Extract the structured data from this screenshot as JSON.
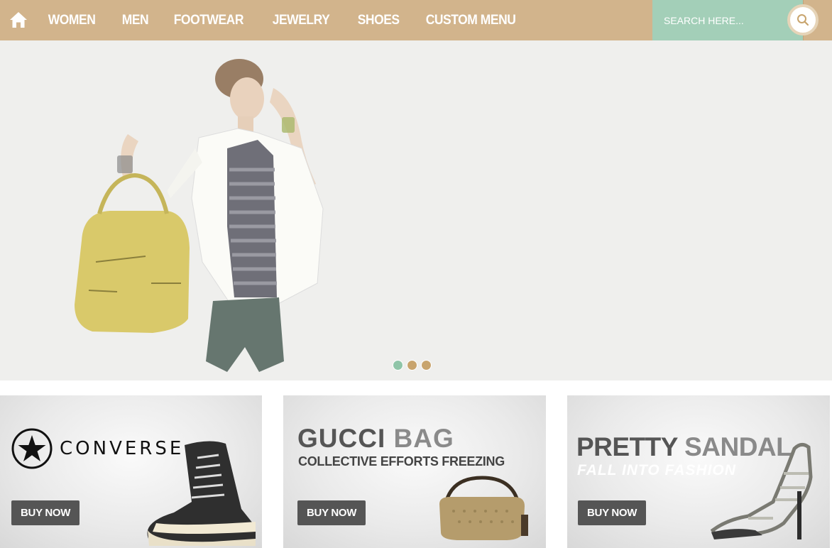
{
  "nav": {
    "home_icon": "home-icon",
    "items": [
      {
        "label": "WOMEN"
      },
      {
        "label": "MEN"
      },
      {
        "label": "FOOTWEAR"
      },
      {
        "label": "JEWELRY"
      },
      {
        "label": "SHOES"
      },
      {
        "label": "CUSTOM MENU"
      }
    ],
    "search": {
      "placeholder": "SEARCH HERE...",
      "icon": "search-icon"
    }
  },
  "slider": {
    "dots": [
      {
        "state": "active"
      },
      {
        "state": "inactive"
      },
      {
        "state": "inactive"
      }
    ]
  },
  "promos": [
    {
      "brand_text": "CONVERSE",
      "button_label": "BUY NOW"
    },
    {
      "title_dark": "GUCCI",
      "title_light": "BAG",
      "subtitle": "COLLECTIVE EFFORTS FREEZING",
      "button_label": "BUY NOW"
    },
    {
      "title_dark": "PRETTY",
      "title_light": "SANDAL",
      "subtitle": "FALL INTO FASHION",
      "button_label": "BUY NOW"
    }
  ],
  "colors": {
    "nav_bg": "#d2b48c",
    "search_bg": "#a3cfb8",
    "button_bg": "#555555",
    "dot_active": "#8fc5a8",
    "dot_inactive": "#c8a46d"
  }
}
